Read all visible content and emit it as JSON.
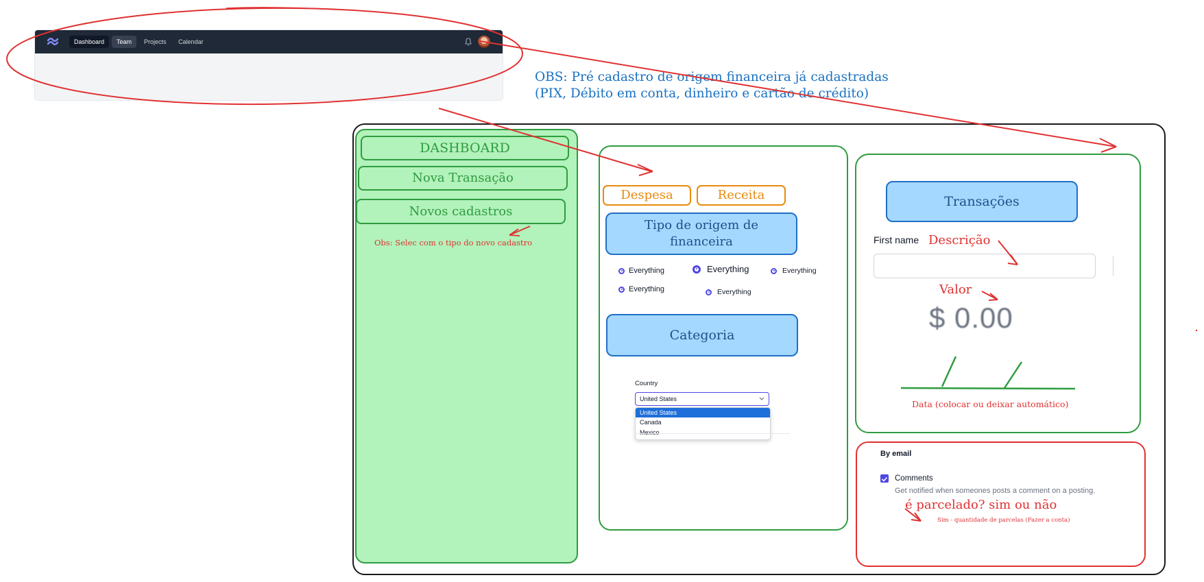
{
  "navbar": {
    "items": [
      "Dashboard",
      "Team",
      "Projects",
      "Calendar"
    ]
  },
  "notes": {
    "obs_top_1": "OBS: Pré cadastro de origem financeira já cadastradas",
    "obs_top_2": "(PIX, Débito em conta, dinheiro e cartão de crédito)",
    "obs_sidebar": "Obs: Selec com o tipo do novo cadastro",
    "data_note": "Data (colocar ou deixar automático)",
    "parcelado": "é parcelado? sim ou não",
    "parcelas_note": "Sim - quantidade de parcelas (Fazer a conta)"
  },
  "sidebar": {
    "dashboard": "DASHBOARD",
    "nova_transacao": "Nova Transação",
    "novos_cadastros": "Novos cadastros"
  },
  "middle": {
    "despesa": "Despesa",
    "receita": "Receita",
    "tipo_origem": "Tipo de origem de financeira",
    "radios": [
      "Everything",
      "Everything",
      "Everything",
      "Everything",
      "Everything"
    ],
    "categoria": "Categoria",
    "country_label": "Country",
    "country_selected": "United States",
    "country_options": [
      "United States",
      "Canada",
      "Mexico"
    ]
  },
  "right": {
    "transacoes": "Transações",
    "first_name": "First name",
    "descricao": "Descrição",
    "valor": "Valor",
    "amount": "$ 0.00",
    "by_email": "By email",
    "comments": "Comments",
    "comments_desc": "Get notified when someones posts a comment on a posting."
  },
  "colors": {
    "green_border": "#2e9c3f",
    "green_fill": "#b2f2bb",
    "blue_fill": "#a5d8ff",
    "blue_border": "#1e6fc5",
    "orange": "#e88a0c",
    "red": "#e03131",
    "annotation_blue": "#1971c2",
    "nav_dark": "#1f2937",
    "accent_indigo": "#4f46e5"
  },
  "icons": [
    "tailwind-logo-icon",
    "bell-icon",
    "avatar",
    "chevron-down-icon",
    "checkbox-checked-icon"
  ]
}
